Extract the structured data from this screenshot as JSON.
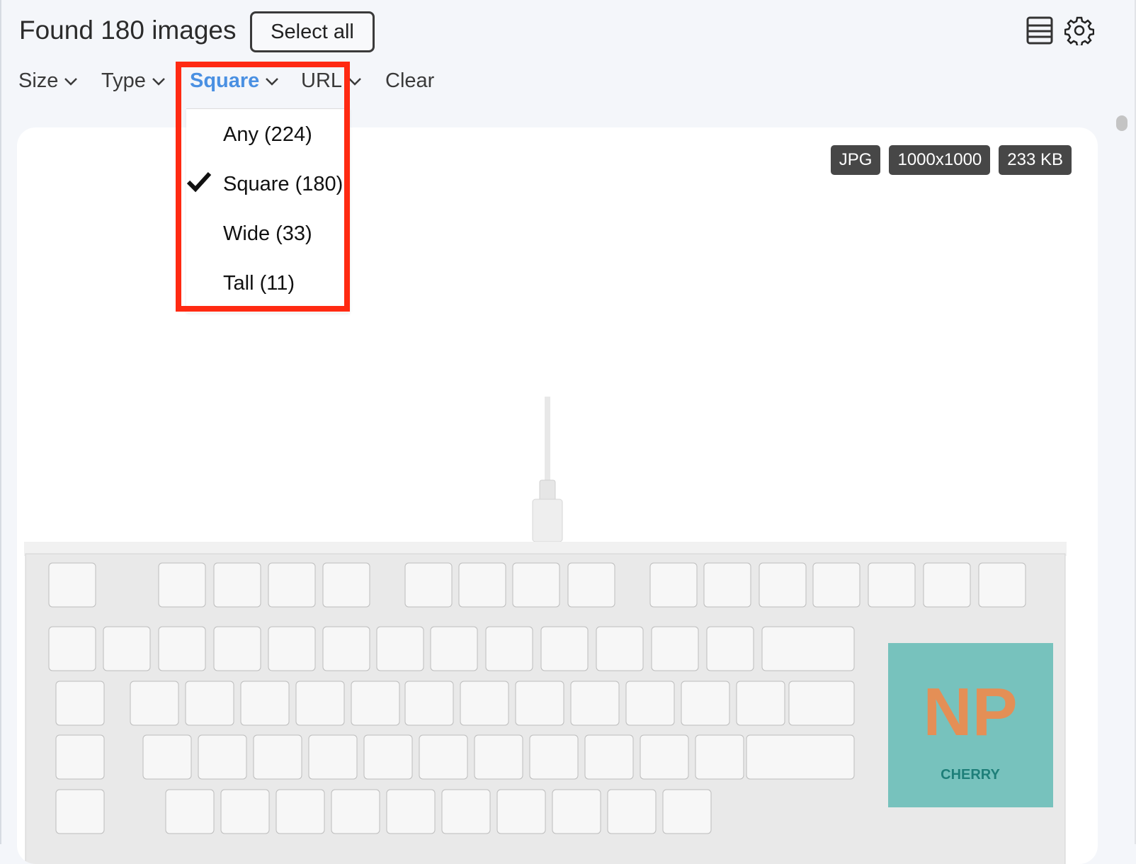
{
  "header": {
    "title": "Found 180 images",
    "select_all_label": "Select all",
    "list_view_icon": "list-view-icon",
    "settings_icon": "gear-icon"
  },
  "filters": {
    "size_label": "Size",
    "type_label": "Type",
    "shape_label": "Square",
    "url_label": "URL",
    "clear_label": "Clear"
  },
  "dropdown": {
    "items": [
      {
        "label": "Any (224)",
        "checked": false
      },
      {
        "label": "Square (180)",
        "checked": true
      },
      {
        "label": "Wide (33)",
        "checked": false
      },
      {
        "label": "Tall (11)",
        "checked": false
      }
    ]
  },
  "image_card": {
    "format": "JPG",
    "dimensions": "1000x1000",
    "file_size": "233 KB",
    "watermark_text": "NP",
    "brand_text": "CHERRY"
  },
  "colors": {
    "accent": "#4a90e2",
    "highlight": "#ff2a12",
    "badge_bg": "#474747"
  }
}
